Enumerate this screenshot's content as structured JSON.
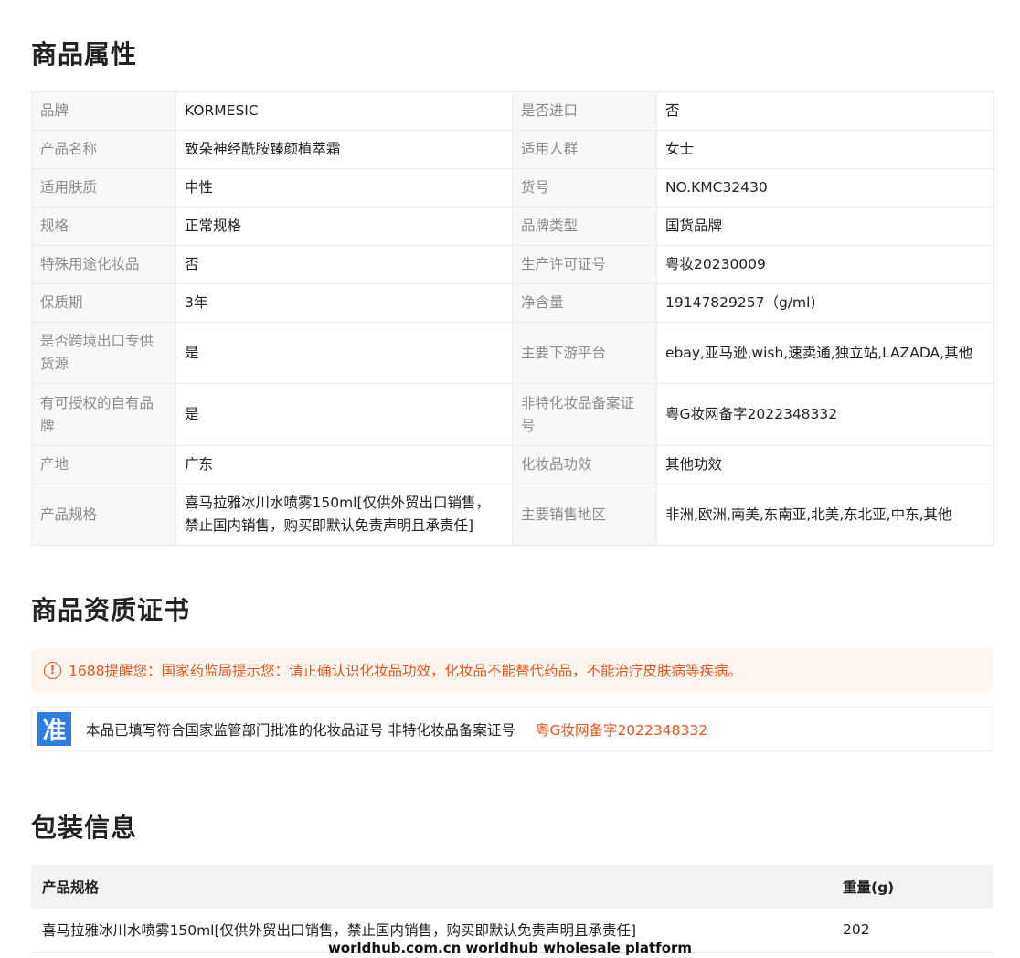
{
  "sections": {
    "attributes_title": "商品属性",
    "certificate_title": "商品资质证书",
    "packaging_title": "包装信息"
  },
  "attributes": [
    {
      "k1": "品牌",
      "v1": "KORMESIC",
      "k2": "是否进口",
      "v2": "否"
    },
    {
      "k1": "产品名称",
      "v1": "致朵神经酰胺臻颜植萃霜",
      "k2": "适用人群",
      "v2": "女士"
    },
    {
      "k1": "适用肤质",
      "v1": "中性",
      "k2": "货号",
      "v2": "NO.KMC32430"
    },
    {
      "k1": "规格",
      "v1": "正常规格",
      "k2": "品牌类型",
      "v2": "国货品牌"
    },
    {
      "k1": "特殊用途化妆品",
      "v1": "否",
      "k2": "生产许可证号",
      "v2": "粤妆20230009"
    },
    {
      "k1": "保质期",
      "v1": "3年",
      "k2": "净含量",
      "v2": "19147829257（g/ml)"
    },
    {
      "k1": "是否跨境出口专供货源",
      "v1": "是",
      "k2": "主要下游平台",
      "v2": "ebay,亚马逊,wish,速卖通,独立站,LAZADA,其他"
    },
    {
      "k1": "有可授权的自有品牌",
      "v1": "是",
      "k2": "非特化妆品备案证号",
      "v2": "粤G妆网备字2022348332"
    },
    {
      "k1": "产地",
      "v1": "广东",
      "k2": "化妆品功效",
      "v2": "其他功效"
    },
    {
      "k1": "产品规格",
      "v1": "喜马拉雅冰川水喷雾150ml[仅供外贸出口销售，禁止国内销售，购买即默认免责声明且承责任]",
      "k2": "主要销售地区",
      "v2": "非洲,欧洲,南美,东南亚,北美,东北亚,中东,其他"
    }
  ],
  "notice": {
    "icon": "exclamation-circle-icon",
    "text": "1688提醒您：国家药监局提示您：请正确认识化妆品功效，化妆品不能替代药品，不能治疗皮肤病等疾病。"
  },
  "certificate": {
    "badge": "准",
    "text": "本品已填写符合国家监管部门批准的化妆品证号 非特化妆品备案证号",
    "number": "粤G妆网备字2022348332"
  },
  "packaging": {
    "headers": [
      "产品规格",
      "重量(g)"
    ],
    "rows": [
      {
        "spec": "喜马拉雅冰川水喷雾150ml[仅供外贸出口销售，禁止国内销售，购买即默认免责声明且承责任]",
        "weight": "202"
      }
    ]
  },
  "watermark": "worldhub.com.cn worldhub wholesale platform",
  "colors": {
    "accent": "#e8541e",
    "badge": "#2e7de1",
    "label_bg": "#f8f8f8",
    "notice_bg": "#fff5ef"
  }
}
